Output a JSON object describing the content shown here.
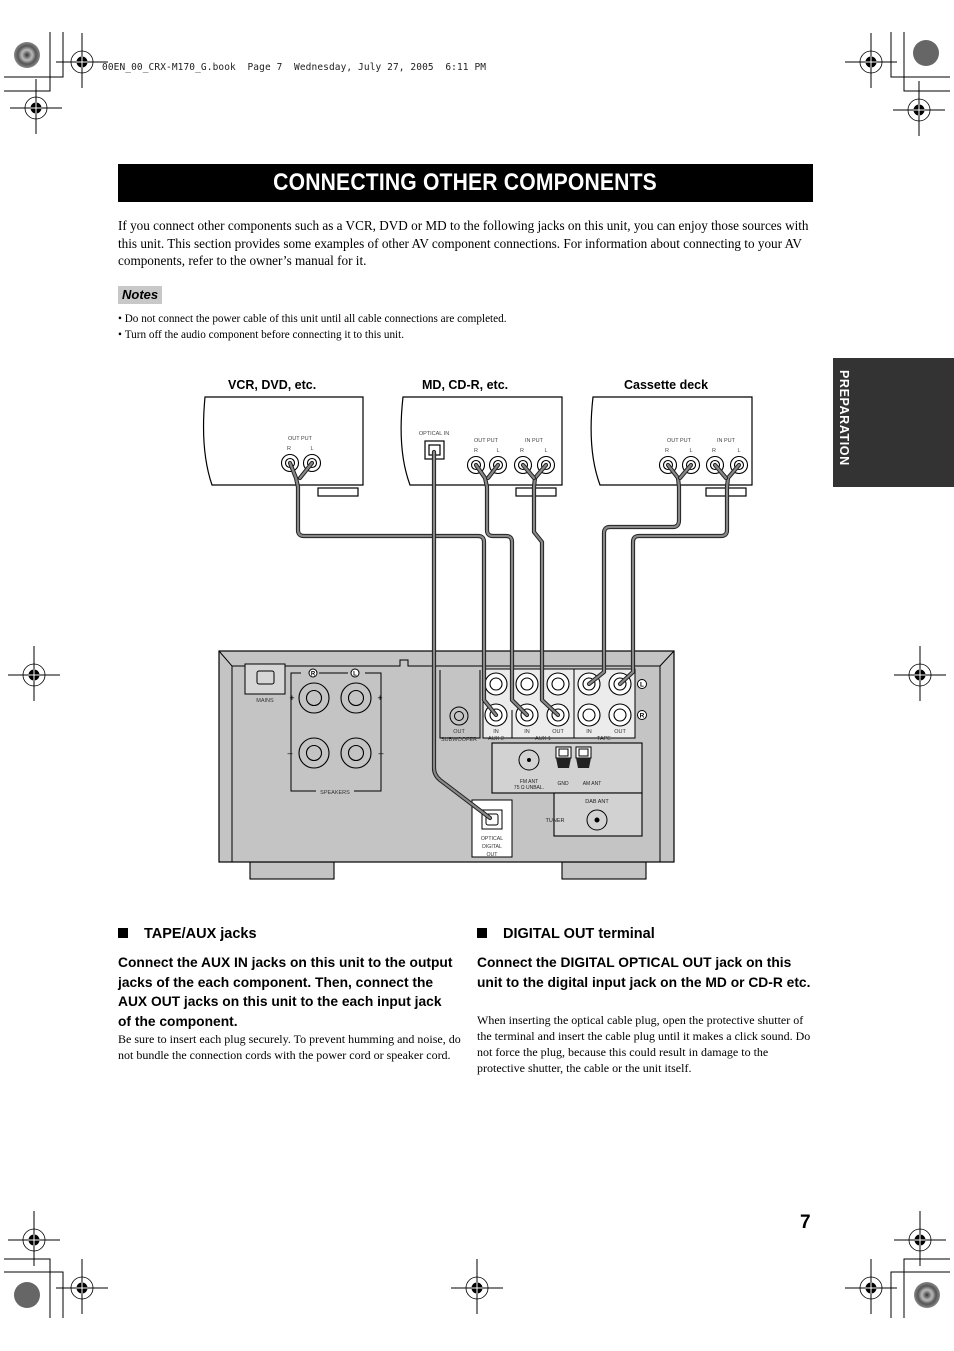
{
  "print_header": "00EN_00_CRX-M170_G.book  Page 7  Wednesday, July 27, 2005  6:11 PM",
  "title": "CONNECTING OTHER COMPONENTS",
  "intro": "If you connect other components such as a VCR, DVD or MD to the following jacks on this unit, you can enjoy those sources with this unit. This section provides some examples of other AV component connections. For information about connecting to your AV components, refer to the owner’s manual for it.",
  "notes": {
    "label": "Notes",
    "items": [
      "Do not connect the power cable of this unit until all cable connections are completed.",
      "Turn off the audio component before connecting it to this unit."
    ]
  },
  "side_tab": "PREPARATION",
  "diagram": {
    "components": [
      {
        "label": "VCR, DVD, etc.",
        "jack_groups": [
          {
            "label": "OUT PUT",
            "channels": [
              "R",
              "L"
            ]
          }
        ]
      },
      {
        "label": "MD, CD-R, etc.",
        "optical_label": "OPTICAL IN",
        "jack_groups": [
          {
            "label": "OUT PUT",
            "channels": [
              "R",
              "L"
            ]
          },
          {
            "label": "IN PUT",
            "channels": [
              "R",
              "L"
            ]
          }
        ]
      },
      {
        "label": "Cassette deck",
        "jack_groups": [
          {
            "label": "OUT PUT",
            "channels": [
              "R",
              "L"
            ]
          },
          {
            "label": "IN PUT",
            "channels": [
              "R",
              "L"
            ]
          }
        ]
      }
    ],
    "unit": {
      "mains": "MAINS",
      "speakers": "SPEAKERS",
      "speaker_channels": [
        "R",
        "L"
      ],
      "plus": "+",
      "minus": "–",
      "subwoofer_out": "OUT",
      "subwoofer": "SUBWOOFER",
      "in": "IN",
      "out": "OUT",
      "aux2": "AUX 2",
      "aux1": "AUX 1",
      "tape": "TAPE",
      "channel_l": "L",
      "channel_r": "R",
      "fm_ant": "FM ANT",
      "fm_ohm": "75 Ω UNBAL.",
      "gnd": "GND",
      "am_ant": "AM ANT",
      "dab_ant": "DAB ANT",
      "tuner": "TUNER",
      "optical_lines": [
        "OPTICAL",
        "DIGITAL",
        "OUT"
      ]
    }
  },
  "sections": [
    {
      "heading": "TAPE/AUX jacks",
      "lead": "Connect the AUX IN jacks on this unit to the output jacks of the each component. Then, connect the AUX OUT jacks on this unit to the each input jack of the component.",
      "body": "Be sure to insert each plug securely. To prevent humming and noise, do not bundle the connection cords with the power cord or speaker cord."
    },
    {
      "heading": "DIGITAL OUT terminal",
      "lead": "Connect the DIGITAL OPTICAL OUT jack on this unit to the digital input jack on the MD or CD-R etc.",
      "body": "When inserting the optical cable plug, open the protective shutter of the terminal and insert the cable plug until it makes a click sound. Do not force the plug, because this could result in damage to the protective shutter, the cable or the unit itself."
    }
  ],
  "page_number": "7"
}
